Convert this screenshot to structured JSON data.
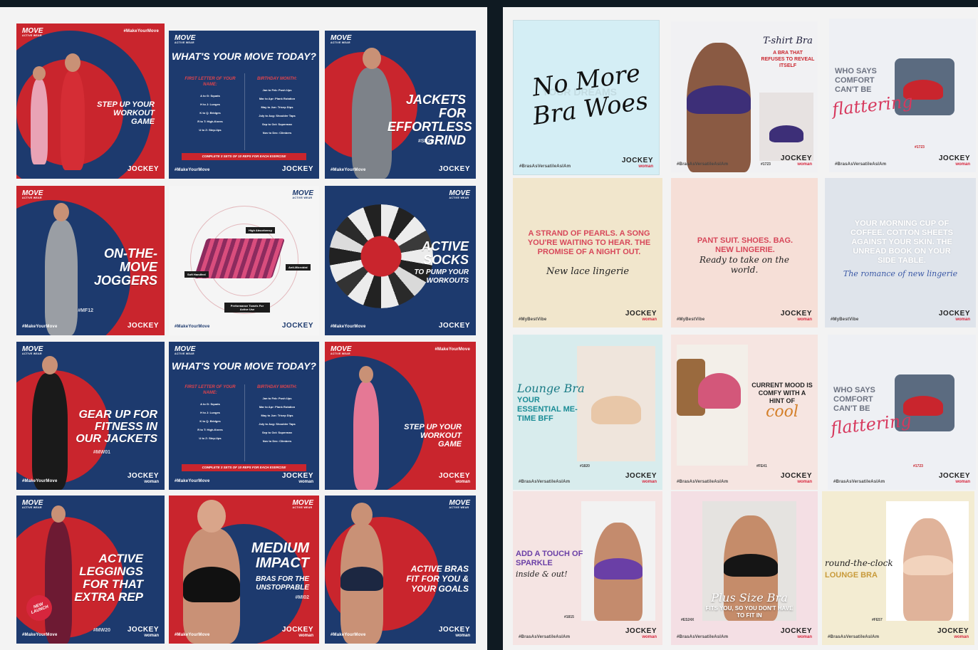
{
  "left_panel": {
    "tiles": [
      {
        "move": "MOVE",
        "move_sub": "ACTIVE WEAR",
        "hash": "#MakeYourMove",
        "headline": "STEP UP YOUR WORKOUT GAME",
        "brand": "JOCKEY"
      },
      {
        "move": "MOVE",
        "move_sub": "ACTIVE WEAR",
        "title": "WHAT'S YOUR MOVE TODAY?",
        "col1_head": "FIRST LETTER OF YOUR NAME:",
        "col1": [
          "A to G: Squats",
          "H to J: Lunges",
          "K to Q: Bridges",
          "R to T: High-Knees",
          "U to Z: Step-Ups"
        ],
        "col2_head": "BIRTHDAY MONTH:",
        "col2": [
          "Jan to Feb: Push Ups",
          "Mar to Apr: Plank Rotation",
          "May to Jun: Tricep Dips",
          "July to Aug: Shoulder Taps",
          "Sep to Oct: Superman",
          "Nov to Dec: Climbers"
        ],
        "bar": "COMPLETE 3 SETS OF 10 REPS FOR EACH EXERCISE",
        "hash": "#MakeYourMove",
        "brand": "JOCKEY"
      },
      {
        "move": "MOVE",
        "move_sub": "ACTIVE WEAR",
        "headline": "JACKETS FOR EFFORTLESS GRIND",
        "code": "#SP17",
        "brand": "JOCKEY",
        "hash": "#MakeYourMove"
      },
      {
        "move": "MOVE",
        "move_sub": "ACTIVE WEAR",
        "headline": "ON-THE-MOVE JOGGERS",
        "code": "#MF12",
        "hash": "#MakeYourMove",
        "brand": "JOCKEY"
      },
      {
        "move": "MOVE",
        "move_sub": "ACTIVE WEAR",
        "labels": [
          "High Absorbency",
          "Soft Handfeel",
          "Anti-Microbial",
          "Performance Towels For Active Use"
        ],
        "hash": "#MakeYourMove",
        "brand": "JOCKEY"
      },
      {
        "move": "MOVE",
        "move_sub": "ACTIVE WEAR",
        "headline": "ACTIVE SOCKS",
        "sub": "TO PUMP YOUR WORKOUTS",
        "hash": "#MakeYourMove",
        "brand": "JOCKEY"
      },
      {
        "move": "MOVE",
        "move_sub": "ACTIVE WEAR",
        "headline": "GEAR UP FOR FITNESS IN OUR JACKETS",
        "code": "#MW01",
        "hash": "#MakeYourMove",
        "brand": "JOCKEY",
        "brand_sub": "woman"
      },
      {
        "move": "MOVE",
        "move_sub": "ACTIVE WEAR",
        "title": "WHAT'S YOUR MOVE TODAY?",
        "col1_head": "FIRST LETTER OF YOUR NAME:",
        "col1": [
          "A to G: Squats",
          "H to J: Lunges",
          "K to Q: Bridges",
          "R to T: High-Knees",
          "U to Z: Step-Ups"
        ],
        "col2_head": "BIRTHDAY MONTH:",
        "col2": [
          "Jan to Feb: Push Ups",
          "Mar to Apr: Plank Rotation",
          "May to Jun: Tricep Dips",
          "July to Aug: Shoulder Taps",
          "Sep to Oct: Superman",
          "Nov to Dec: Climbers"
        ],
        "bar": "COMPLETE 3 SETS OF 10 REPS FOR EACH EXERCISE",
        "hash": "#MakeYourMove",
        "brand": "JOCKEY",
        "brand_sub": "woman"
      },
      {
        "move": "MOVE",
        "move_sub": "ACTIVE WEAR",
        "hash": "#MakeYourMove",
        "headline": "STEP UP YOUR WORKOUT GAME",
        "brand": "JOCKEY",
        "brand_sub": "woman"
      },
      {
        "move": "MOVE",
        "move_sub": "ACTIVE WEAR",
        "headline": "ACTIVE LEGGINGS FOR THAT EXTRA REP",
        "badge": "NEW LAUNCH",
        "code": "#MW20",
        "hash": "#MakeYourMove",
        "brand": "JOCKEY",
        "brand_sub": "woman"
      },
      {
        "move": "MOVE",
        "move_sub": "ACTIVE WEAR",
        "headline": "MEDIUM IMPACT",
        "sub": "BRAS FOR THE UNSTOPPABLE",
        "code": "#MI02",
        "hash": "#MakeYourMove",
        "brand": "JOCKEY",
        "brand_sub": "woman"
      },
      {
        "move": "MOVE",
        "move_sub": "ACTIVE WEAR",
        "headline": "ACTIVE BRAS FIT FOR YOU & YOUR GOALS",
        "hash": "#MakeYourMove",
        "brand": "JOCKEY",
        "brand_sub": "woman"
      }
    ]
  },
  "right_panel": {
    "tiles": [
      {
        "script": "No More Bra Woes",
        "ghost": "YOUR DREAMS",
        "hash": "#BrasAsVersatileAsIAm",
        "brand": "JOCKEY",
        "brand_sub": "woman"
      },
      {
        "script": "T-shirt Bra",
        "caption": "A BRA THAT REFUSES TO REVEAL ITSELF",
        "code": "#1723",
        "hash": "#BrasAsVersatileAsIAm",
        "brand": "JOCKEY",
        "brand_sub": "woman"
      },
      {
        "text": "WHO SAYS COMFORT CAN'T BE",
        "script": "flattering",
        "code": "#1723",
        "hash": "#BrasAsVersatileAsIAm",
        "brand": "JOCKEY",
        "brand_sub": "woman"
      },
      {
        "text": "A STRAND OF PEARLS. A SONG YOU'RE WAITING TO HEAR. THE PROMISE OF A NIGHT OUT.",
        "script": "New lace lingerie",
        "hash": "#MyBestVibe",
        "brand": "JOCKEY",
        "brand_sub": "woman"
      },
      {
        "text": "PANT SUIT. SHOES. BAG. NEW LINGERIE.",
        "script": "Ready to take on the world.",
        "hash": "#MyBestVibe",
        "brand": "JOCKEY",
        "brand_sub": "woman"
      },
      {
        "text": "YOUR MORNING CUP OF COFFEE. COTTON SHEETS AGAINST YOUR SKIN. THE UNREAD BOOK ON YOUR SIDE TABLE.",
        "script": "The romance of new lingerie",
        "hash": "#MyBestVibe",
        "brand": "JOCKEY",
        "brand_sub": "woman"
      },
      {
        "script": "Lounge Bra",
        "text": "YOUR ESSENTIAL ME-TIME BFF",
        "code": "#1820",
        "hash": "#BrasAsVersatileAsIAm",
        "brand": "JOCKEY",
        "brand_sub": "woman"
      },
      {
        "text": "CURRENT MOOD IS COMFY WITH A HINT OF",
        "script": "cool",
        "code": "#FE41",
        "hash": "#BrasAsVersatileAsIAm",
        "brand": "JOCKEY",
        "brand_sub": "woman"
      },
      {
        "text": "WHO SAYS COMFORT CAN'T BE",
        "script": "flattering",
        "code": "#1723",
        "hash": "#BrasAsVersatileAsIAm",
        "brand": "JOCKEY",
        "brand_sub": "woman"
      },
      {
        "text": "ADD A TOUCH OF SPARKLE",
        "script": "inside & out!",
        "code": "#1815",
        "hash": "#BrasAsVersatileAsIAm",
        "brand": "JOCKEY",
        "brand_sub": "woman"
      },
      {
        "script": "Plus Size Bra",
        "text": "FITS YOU, SO YOU DON'T HAVE TO FIT IN",
        "code": "#ES24X",
        "hash": "#BrasAsVersatileAsIAm",
        "brand": "JOCKEY",
        "brand_sub": "woman"
      },
      {
        "script": "round-the-clock",
        "text": "LOUNGE BRA",
        "code": "#FE57",
        "hash": "#BrasAsVersatileAsIAm",
        "brand": "JOCKEY",
        "brand_sub": "woman"
      }
    ]
  }
}
